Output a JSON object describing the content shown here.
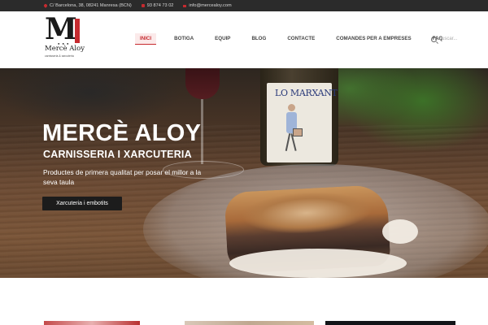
{
  "topbar": {
    "address": "C/ Barcelona, 38, 08241 Manresa (BCN)",
    "phone": "93 874 73 02",
    "email": "info@mercealoy.com",
    "icons": [
      "map-pin-icon",
      "phone-icon",
      "mail-icon"
    ]
  },
  "logo": {
    "letter": "M",
    "brand": "Mercè Aloy",
    "tagline": "carnisseria & xarcuteria",
    "dots": "● ● ●"
  },
  "nav": {
    "items": [
      {
        "label": "INICI",
        "active": true
      },
      {
        "label": "BOTIGA",
        "active": false
      },
      {
        "label": "EQUIP",
        "active": false
      },
      {
        "label": "BLOG",
        "active": false
      },
      {
        "label": "CONTACTE",
        "active": false
      },
      {
        "label": "COMANDES PER A EMPRESES",
        "active": false
      },
      {
        "label": "FAQ",
        "active": false
      }
    ]
  },
  "search": {
    "placeholder": "Buscar..."
  },
  "hero": {
    "title": "MERCÈ ALOY",
    "subtitle": "CARNISSERIA I XARCUTERIA",
    "description": "Productes de primera qualitat per posar el millor a la seva taula",
    "button_label": "Xarcuteria i embotits",
    "bottle_label": "LO MARXANT"
  },
  "colors": {
    "accent": "#c62a2f",
    "topbar_bg": "#2b2b2b",
    "button_bg": "#1c1c1c"
  }
}
